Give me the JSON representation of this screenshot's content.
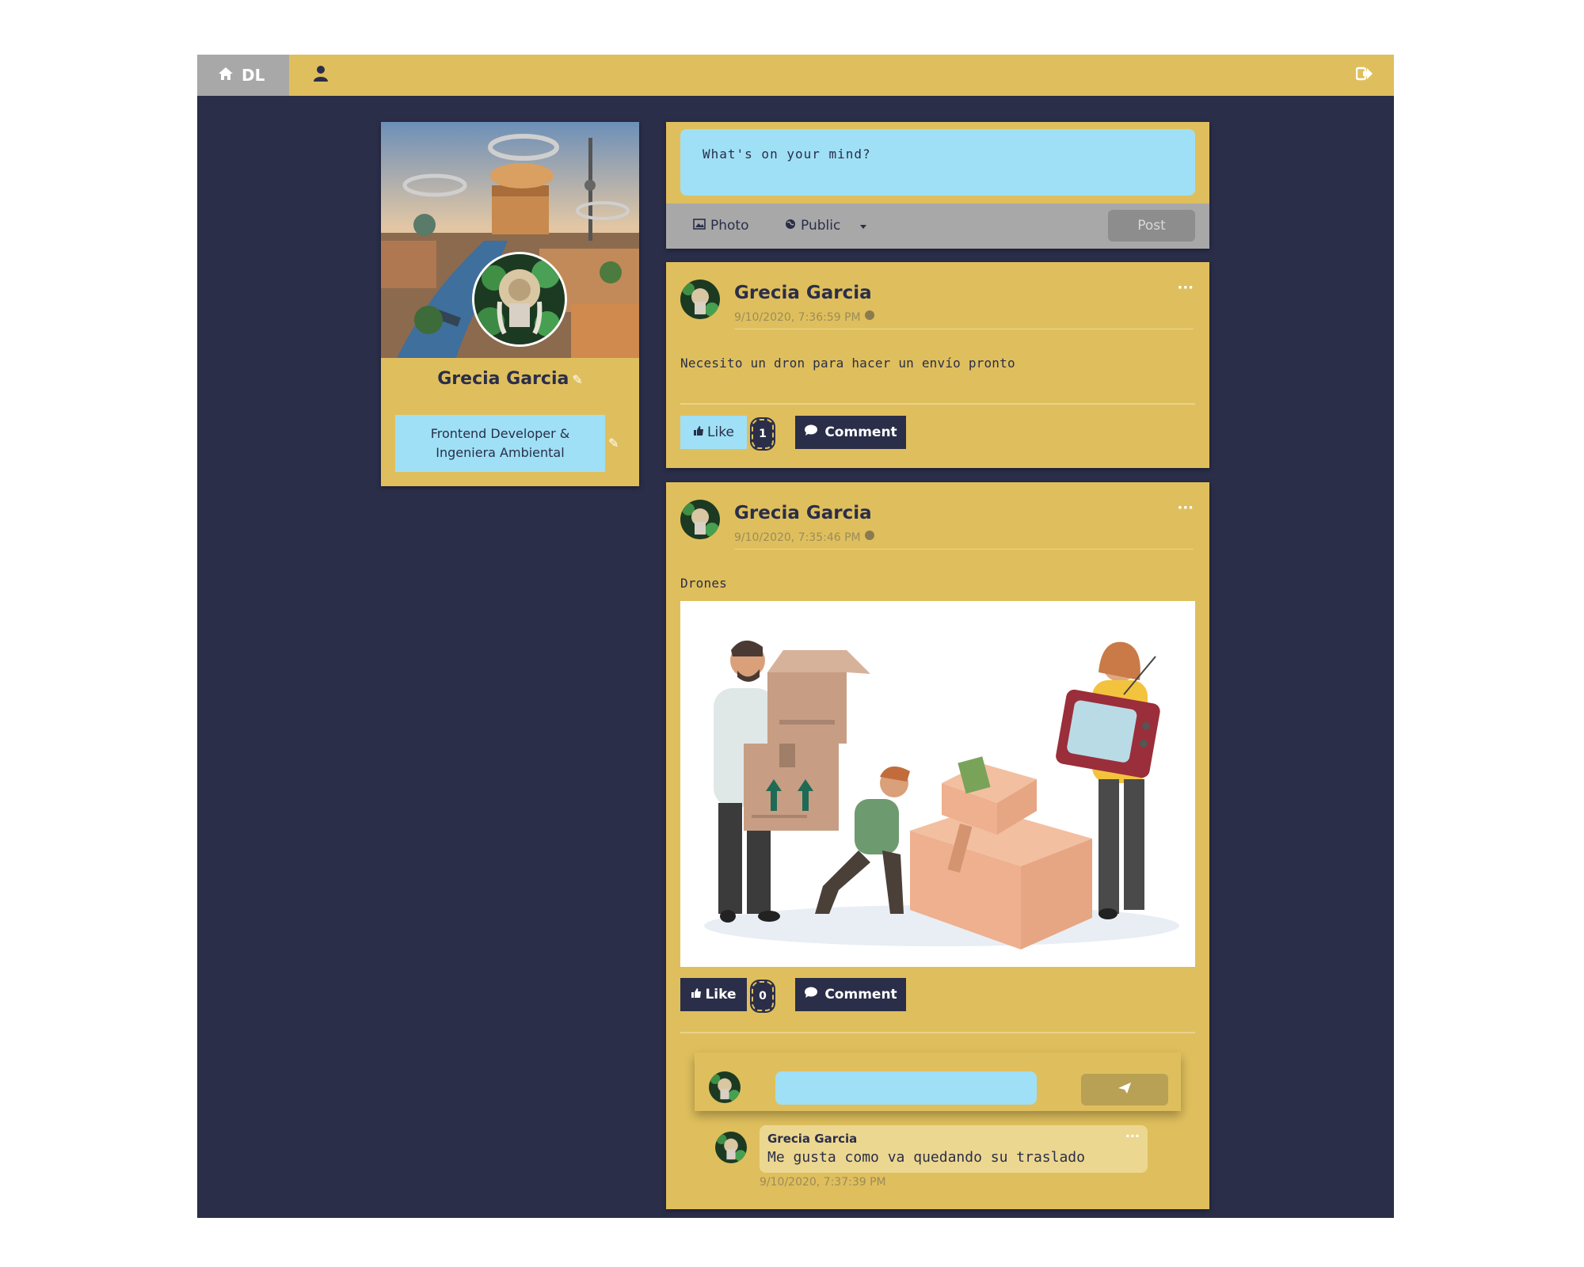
{
  "nav": {
    "brand": "DL",
    "icons": {
      "home": "home-icon",
      "profile": "user-icon",
      "logout": "logout-icon"
    }
  },
  "profile": {
    "name": "Grecia Garcia",
    "bio": "Frontend Developer &\nIngeniera Ambiental",
    "icons": {
      "edit": "edit-icon"
    }
  },
  "composer": {
    "placeholder": "What's on your mind?",
    "photo_label": "Photo",
    "privacy_label": "Public",
    "post_label": "Post"
  },
  "posts": [
    {
      "author": "Grecia Garcia",
      "time": "9/10/2020, 7:36:59 PM",
      "text": "Necesito un dron para hacer un envío pronto",
      "like_label": "Like",
      "likes": "1",
      "comment_label": "Comment"
    },
    {
      "author": "Grecia Garcia",
      "time": "9/10/2020, 7:35:46 PM",
      "text": "Drones",
      "like_label": "Like",
      "likes": "0",
      "comment_label": "Comment",
      "comments": [
        {
          "author": "Grecia Garcia",
          "text": "Me gusta como va quedando su traslado",
          "time": "9/10/2020, 7:37:39 PM"
        }
      ]
    }
  ],
  "colors": {
    "navy": "#2a2e49",
    "gold": "#dfbf5d",
    "sky": "#9fe0f6",
    "gray": "#a8a8a8"
  }
}
